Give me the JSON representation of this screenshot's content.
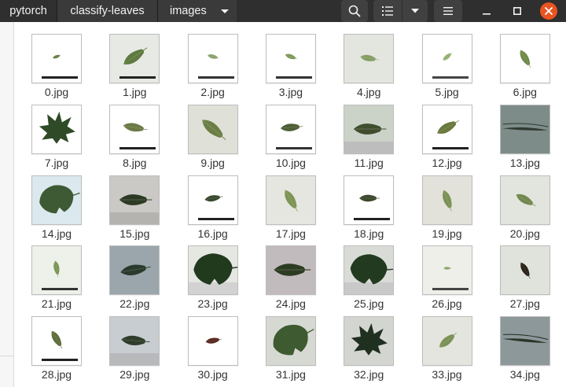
{
  "window": {
    "breadcrumbs": [
      "pytorch",
      "classify-leaves",
      "images"
    ],
    "icons": {
      "search": "search-icon",
      "view": "list-view-icon",
      "view_menu": "chevron-down-icon",
      "menu": "hamburger-menu-icon",
      "minimize": "minimize-icon",
      "maximize": "maximize-icon",
      "close": "close-icon"
    },
    "colors": {
      "header_bg": "#2f2f2f",
      "close_accent": "#e95420"
    }
  },
  "files": [
    {
      "name": "0.jpg",
      "bg": "#ffffff",
      "leaf": "#6a7f4a",
      "size": 0.22,
      "angle": -20,
      "bar": "#222222",
      "band": ""
    },
    {
      "name": "1.jpg",
      "bg": "#e7e9e4",
      "leaf": "#5f7a3f",
      "size": 0.7,
      "angle": -35,
      "bar": "#222222",
      "band": ""
    },
    {
      "name": "2.jpg",
      "bg": "#ffffff",
      "leaf": "#8aa26a",
      "size": 0.3,
      "angle": 15,
      "bar": "#333333",
      "band": ""
    },
    {
      "name": "3.jpg",
      "bg": "#ffffff",
      "leaf": "#7d9a58",
      "size": 0.32,
      "angle": 20,
      "bar": "#333333",
      "band": ""
    },
    {
      "name": "4.jpg",
      "bg": "#e3e5df",
      "leaf": "#849f63",
      "size": 0.45,
      "angle": 10,
      "bar": "",
      "band": ""
    },
    {
      "name": "5.jpg",
      "bg": "#ffffff",
      "leaf": "#93b26e",
      "size": 0.3,
      "angle": -40,
      "bar": "#444444",
      "band": ""
    },
    {
      "name": "6.jpg",
      "bg": "#ffffff",
      "leaf": "#6f8a4a",
      "size": 0.5,
      "angle": 60,
      "bar": "",
      "band": ""
    },
    {
      "name": "7.jpg",
      "bg": "#ffffff",
      "leaf": "#2f4a26",
      "size": 0.85,
      "angle": 0,
      "bar": "",
      "band": "",
      "shape": "palmate"
    },
    {
      "name": "8.jpg",
      "bg": "#ffffff",
      "leaf": "#6b7a46",
      "size": 0.6,
      "angle": 10,
      "bar": "#222222",
      "band": ""
    },
    {
      "name": "9.jpg",
      "bg": "#dfe1d8",
      "leaf": "#6b7f45",
      "size": 0.75,
      "angle": 40,
      "bar": "",
      "band": ""
    },
    {
      "name": "10.jpg",
      "bg": "#ffffff",
      "leaf": "#4f5e36",
      "size": 0.55,
      "angle": -5,
      "bar": "#333333",
      "band": ""
    },
    {
      "name": "11.jpg",
      "bg": "#cbd2c8",
      "leaf": "#3f4e2e",
      "size": 0.8,
      "angle": 0,
      "bar": "",
      "band": "#bdbdbd"
    },
    {
      "name": "12.jpg",
      "bg": "#ffffff",
      "leaf": "#6a7a3e",
      "size": 0.62,
      "angle": -30,
      "bar": "#222222",
      "band": ""
    },
    {
      "name": "13.jpg",
      "bg": "#7d8c89",
      "leaf": "#2f3a30",
      "size": 0.9,
      "angle": 5,
      "bar": "",
      "band": "",
      "shape": "needle"
    },
    {
      "name": "14.jpg",
      "bg": "#dbe9ef",
      "leaf": "#3d5a34",
      "size": 0.85,
      "angle": -10,
      "bar": "",
      "band": "",
      "shape": "lobed"
    },
    {
      "name": "15.jpg",
      "bg": "#cbc9c6",
      "leaf": "#2c3a24",
      "size": 0.8,
      "angle": 0,
      "bar": "",
      "band": "#b5b3b0"
    },
    {
      "name": "16.jpg",
      "bg": "#ffffff",
      "leaf": "#3a4a30",
      "size": 0.45,
      "angle": -10,
      "bar": "#222222",
      "band": ""
    },
    {
      "name": "17.jpg",
      "bg": "#e5e6df",
      "leaf": "#7e9454",
      "size": 0.6,
      "angle": 60,
      "bar": "",
      "band": ""
    },
    {
      "name": "18.jpg",
      "bg": "#ffffff",
      "leaf": "#3d4a2e",
      "size": 0.5,
      "angle": 0,
      "bar": "#222222",
      "band": ""
    },
    {
      "name": "19.jpg",
      "bg": "#e2e2db",
      "leaf": "#7b9155",
      "size": 0.55,
      "angle": 70,
      "bar": "",
      "band": ""
    },
    {
      "name": "20.jpg",
      "bg": "#e1e5de",
      "leaf": "#72884e",
      "size": 0.55,
      "angle": 30,
      "bar": "",
      "band": ""
    },
    {
      "name": "21.jpg",
      "bg": "#eef0ea",
      "leaf": "#7a9552",
      "size": 0.4,
      "angle": 80,
      "bar": "#333333",
      "band": ""
    },
    {
      "name": "22.jpg",
      "bg": "#9aa6ac",
      "leaf": "#2a3a2c",
      "size": 0.75,
      "angle": -10,
      "bar": "",
      "band": ""
    },
    {
      "name": "23.jpg",
      "bg": "#e5e7e2",
      "leaf": "#213a1e",
      "size": 0.95,
      "angle": 0,
      "bar": "",
      "band": "#d2d2d2",
      "shape": "lobed"
    },
    {
      "name": "24.jpg",
      "bg": "#c2bbbd",
      "leaf": "#2c3c22",
      "size": 0.9,
      "angle": 0,
      "bar": "",
      "band": ""
    },
    {
      "name": "25.jpg",
      "bg": "#d9dcd6",
      "leaf": "#223a1f",
      "size": 0.9,
      "angle": 5,
      "bar": "",
      "band": "#c9c9c9",
      "shape": "lobed"
    },
    {
      "name": "26.jpg",
      "bg": "#eeefe9",
      "leaf": "#8da56a",
      "size": 0.2,
      "angle": 0,
      "bar": "#444444",
      "band": ""
    },
    {
      "name": "27.jpg",
      "bg": "#dfe3dc",
      "leaf": "#2a2218",
      "size": 0.45,
      "angle": 60,
      "bar": "",
      "band": ""
    },
    {
      "name": "28.jpg",
      "bg": "#ffffff",
      "leaf": "#5f6e3a",
      "size": 0.5,
      "angle": 60,
      "bar": "#222222",
      "band": ""
    },
    {
      "name": "29.jpg",
      "bg": "#c8cdd1",
      "leaf": "#2f3e2a",
      "size": 0.7,
      "angle": 5,
      "bar": "",
      "band": "#b7b9bb"
    },
    {
      "name": "30.jpg",
      "bg": "#ffffff",
      "leaf": "#5a2a1e",
      "size": 0.4,
      "angle": -10,
      "bar": "",
      "band": ""
    },
    {
      "name": "31.jpg",
      "bg": "#d6d9d2",
      "leaf": "#3e5a30",
      "size": 0.9,
      "angle": -20,
      "bar": "",
      "band": "",
      "shape": "lobed"
    },
    {
      "name": "32.jpg",
      "bg": "#d2d5d0",
      "leaf": "#1f2f20",
      "size": 0.85,
      "angle": 0,
      "bar": "",
      "band": "",
      "shape": "palmate"
    },
    {
      "name": "33.jpg",
      "bg": "#e3e5de",
      "leaf": "#7c9157",
      "size": 0.55,
      "angle": -40,
      "bar": "",
      "band": ""
    },
    {
      "name": "34.jpg",
      "bg": "#8d989b",
      "leaf": "#2a3528",
      "size": 0.9,
      "angle": 8,
      "bar": "",
      "band": "",
      "shape": "needle"
    }
  ]
}
